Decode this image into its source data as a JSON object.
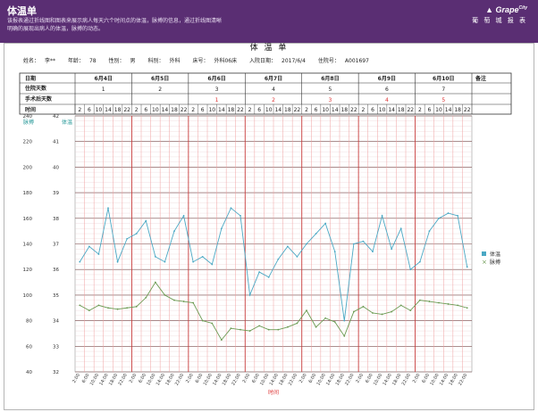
{
  "header": {
    "title": "体温单",
    "description": "该报表通过折线图和图表来展示病人每天六个时间点的体温，脉搏的信息，通过折线图清晰明确的展现出病人的体温，脉搏的动态。",
    "brand": "Grape",
    "brand_cn": "葡 萄 城 报 表"
  },
  "report": {
    "title": "体 温 单"
  },
  "patient": {
    "name_label": "姓名：",
    "name": "李**",
    "age_label": "年龄：",
    "age": "78",
    "gender_label": "性别：",
    "gender": "男",
    "department_label": "科别：",
    "department": "外科",
    "bed_label": "床号：",
    "bed": "外科06床",
    "admit_label": "入院日期：",
    "admit_date": "2017/6/4",
    "admission_no_label": "住院号：",
    "admission_no": "A001697"
  },
  "table": {
    "row_labels": {
      "date": "日期",
      "hospital_days": "住院天数",
      "post_op_days": "手术后天数",
      "time": "时间"
    },
    "remark_label": "备注",
    "dates": [
      "6月4日",
      "6月5日",
      "6月6日",
      "6月7日",
      "6月8日",
      "6月9日",
      "6月10日"
    ],
    "hospital_days": [
      "1",
      "2",
      "3",
      "4",
      "5",
      "6",
      "7"
    ],
    "post_op_days": [
      "",
      "",
      "1",
      "2",
      "3",
      "4",
      "5"
    ],
    "time_slots": [
      "2",
      "6",
      "10",
      "14",
      "18",
      "22"
    ]
  },
  "chart_data": {
    "type": "line",
    "x": [
      "2:00",
      "6:00",
      "10:00",
      "14:00",
      "18:00",
      "22:00",
      "2:00",
      "6:00",
      "10:00",
      "14:00",
      "18:00",
      "22:00",
      "2:00",
      "6:00",
      "10:00",
      "14:00",
      "18:00",
      "22:00",
      "2:00",
      "6:00",
      "10:00",
      "14:00",
      "18:00",
      "22:00",
      "2:00",
      "6:00",
      "10:00",
      "14:00",
      "18:00",
      "22:00",
      "2:00",
      "6:00",
      "10:00",
      "14:00",
      "18:00",
      "22:00",
      "2:00",
      "6:00",
      "10:00",
      "14:00",
      "18:00",
      "22:00"
    ],
    "xlabel": "时间",
    "left_axis": {
      "label": "脉搏",
      "ylim": [
        40,
        240
      ],
      "ticks": [
        40,
        60,
        80,
        100,
        120,
        140,
        160,
        180,
        200,
        220,
        240
      ]
    },
    "right_axis": {
      "label": "体温",
      "ylim": [
        32,
        42
      ],
      "ticks": [
        32,
        33,
        34,
        35,
        36,
        37,
        38,
        39,
        40,
        41,
        42
      ]
    },
    "series": [
      {
        "name": "体温",
        "axis": "right",
        "color": "#4aa8c4",
        "values": [
          36.3,
          36.9,
          36.6,
          38.4,
          36.3,
          37.2,
          37.4,
          37.9,
          36.5,
          36.3,
          37.5,
          38.1,
          36.3,
          36.5,
          36.2,
          37.6,
          38.4,
          38.1,
          35.0,
          35.9,
          35.7,
          36.4,
          36.9,
          36.5,
          37.0,
          37.4,
          37.8,
          36.7,
          34.0,
          37.0,
          37.1,
          36.7,
          38.1,
          36.8,
          37.6,
          36.0,
          36.3,
          37.5,
          38.0,
          38.2,
          38.1,
          36.1
        ]
      },
      {
        "name": "脉搏",
        "axis": "left",
        "color": "#6b9a52",
        "values": [
          92,
          88,
          92,
          90,
          89,
          90,
          91,
          98,
          110,
          100,
          96,
          95,
          94,
          80,
          78,
          65,
          74,
          73,
          72,
          76,
          73,
          73,
          75,
          78,
          88,
          75,
          82,
          79,
          68,
          87,
          91,
          86,
          85,
          87,
          92,
          88,
          96,
          95,
          94,
          93,
          92,
          90
        ]
      }
    ],
    "legend": {
      "position": "right"
    },
    "grid": true
  }
}
